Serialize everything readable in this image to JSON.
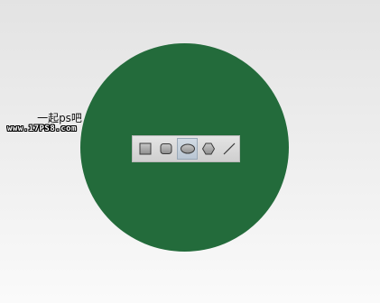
{
  "canvas": {
    "background_top": "#e3e3e3",
    "background_bottom": "#fafafa",
    "circle_color": "#236b3b"
  },
  "watermark": {
    "line1": "一起ps吧",
    "line2": "www.17PS8.com"
  },
  "toolbar": {
    "tools": [
      {
        "name": "rectangle-tool",
        "icon": "rectangle-icon",
        "active": false
      },
      {
        "name": "rounded-rectangle-tool",
        "icon": "rounded-rectangle-icon",
        "active": false
      },
      {
        "name": "ellipse-tool",
        "icon": "ellipse-icon",
        "active": true
      },
      {
        "name": "polygon-tool",
        "icon": "polygon-icon",
        "active": false
      },
      {
        "name": "line-tool",
        "icon": "line-icon",
        "active": false
      }
    ]
  }
}
